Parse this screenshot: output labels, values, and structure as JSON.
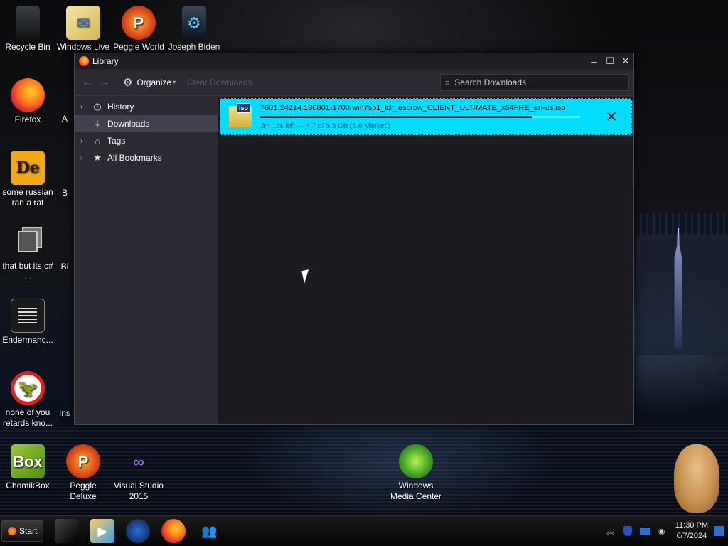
{
  "desktop": {
    "icons": [
      {
        "label": "Recycle Bin",
        "glyph": ""
      },
      {
        "label": "Windows Live",
        "glyph": "✉"
      },
      {
        "label": "Peggle World",
        "glyph": "P"
      },
      {
        "label": "Joseph Biden",
        "glyph": "⚙"
      },
      {
        "label": "Firefox",
        "glyph": ""
      },
      {
        "label": "A",
        "glyph": ""
      },
      {
        "label": "some russian ran a rat",
        "glyph": "De"
      },
      {
        "label": "B",
        "glyph": ""
      },
      {
        "label": "that but its c# ...",
        "glyph": ""
      },
      {
        "label": "Bi",
        "glyph": ""
      },
      {
        "label": "Endermanc...",
        "glyph": ""
      },
      {
        "label": "none of you retards kno...",
        "glyph": "🦖"
      },
      {
        "label": "Ins",
        "glyph": ""
      },
      {
        "label": "ChomikBox",
        "glyph": "Box"
      },
      {
        "label": "Peggle Deluxe",
        "glyph": "P"
      },
      {
        "label": "Visual Studio 2015",
        "glyph": "∞"
      },
      {
        "label": "Windows Media Center",
        "glyph": ""
      }
    ]
  },
  "window": {
    "title": "Library",
    "controls": {
      "minimize": "–",
      "maximize": "☐",
      "close": "✕"
    }
  },
  "toolbar": {
    "back": "←",
    "forward": "→",
    "organize_label": "Organize",
    "organize_caret": "▾",
    "clear_label": "Clear Downloads",
    "search_placeholder": "Search Downloads"
  },
  "sidebar": {
    "items": [
      {
        "label": "History",
        "icon": "clock-icon",
        "twisty": "›",
        "selected": false
      },
      {
        "label": "Downloads",
        "icon": "download-icon",
        "twisty": "",
        "selected": true
      },
      {
        "label": "Tags",
        "icon": "tag-icon",
        "twisty": "›",
        "selected": false
      },
      {
        "label": "All Bookmarks",
        "icon": "star-icon",
        "twisty": "›",
        "selected": false
      }
    ]
  },
  "downloads": [
    {
      "filename": "7601.24214.180801-1700.win7sp1_ldr_escrow_CLIENT_ULTIMATE_x64FRE_en-us.iso",
      "file_badge": "iso",
      "status": "2m 15s left — 4.7 of 5.5 GB (5.6 MB/sec)",
      "progress_percent": 85,
      "cancel_glyph": "✕"
    }
  ],
  "taskbar": {
    "start_label": "Start",
    "clock_time": "11:30 PM",
    "clock_date": "6/7/2024",
    "tray_chevron": "︽"
  },
  "colors": {
    "selection": "#00ddff",
    "window_bg": "#2b2a33",
    "pane_bg": "#1c1b22"
  }
}
